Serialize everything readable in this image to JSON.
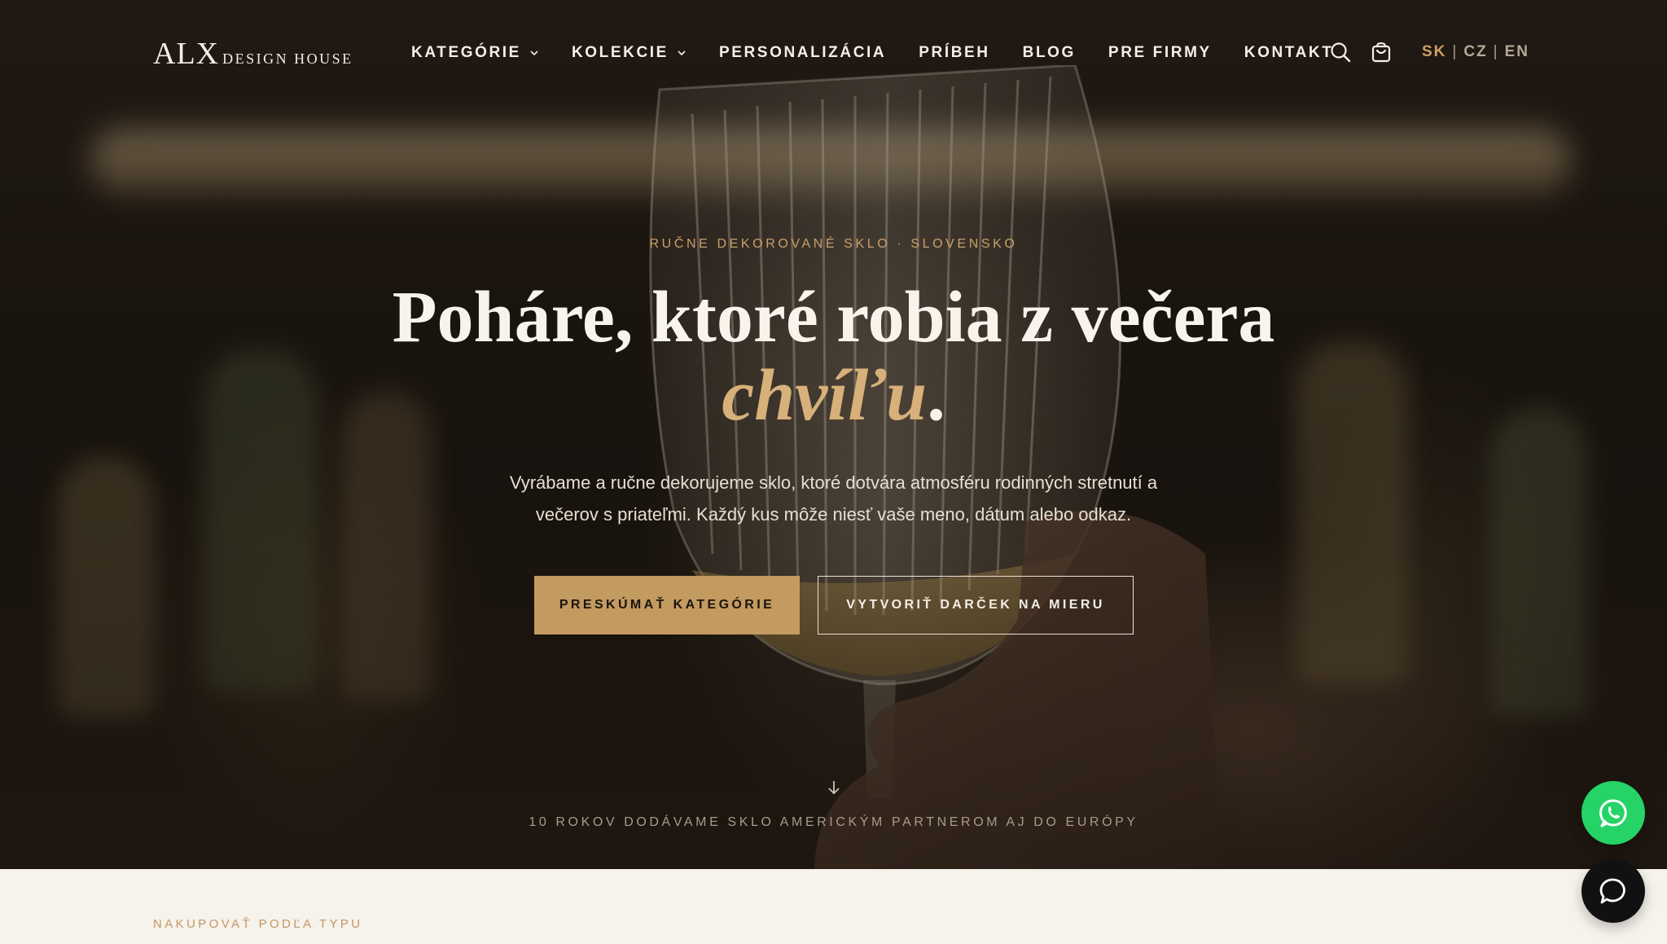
{
  "header": {
    "logo_mark": "ALX",
    "logo_sub": "DESIGN HOUSE",
    "nav": [
      {
        "label": "KATEGÓRIE",
        "has_dropdown": true
      },
      {
        "label": "KOLEKCIE",
        "has_dropdown": true
      },
      {
        "label": "PERSONALIZÁCIA",
        "has_dropdown": false
      },
      {
        "label": "PRÍBEH",
        "has_dropdown": false
      },
      {
        "label": "BLOG",
        "has_dropdown": false
      },
      {
        "label": "PRE FIRMY",
        "has_dropdown": false
      },
      {
        "label": "KONTAKT",
        "has_dropdown": false
      }
    ],
    "icons": [
      "search-icon",
      "shopping-bag-icon"
    ],
    "languages": {
      "active": "SK",
      "sep": "|",
      "other1": "CZ",
      "other2": "EN"
    }
  },
  "hero": {
    "eyebrow": "RUČNE DEKOROVANÉ SKLO · SLOVENSKO",
    "headline_main": "Poháre, ktoré robia z večera",
    "headline_accent": "chvíľu",
    "headline_end": ".",
    "lead": "Vyrábame a ručne dekorujeme sklo, ktoré dotvára atmosféru rodinných stretnutí a večerov s priateľmi. Každý kus môže niesť vaše meno, dátum alebo odkaz.",
    "primary_cta": "PRESKÚMAŤ KATEGÓRIE",
    "secondary_cta": "VYTVORIŤ DARČEK NA MIERU",
    "trust_line": "10 ROKOV DODÁVAME SKLO AMERICKÝM PARTNEROM AJ DO EURÓPY"
  },
  "section": {
    "label": "NAKUPOVAŤ PODĽA TYPU"
  },
  "floating": {
    "whatsapp": "whatsapp-icon",
    "chat": "chat-bubble-icon"
  },
  "colors": {
    "accent_gold": "#c39a5f",
    "headline_accent": "#d7b07a",
    "whatsapp_green": "#25d366",
    "section_bg": "#f6f2ec"
  }
}
